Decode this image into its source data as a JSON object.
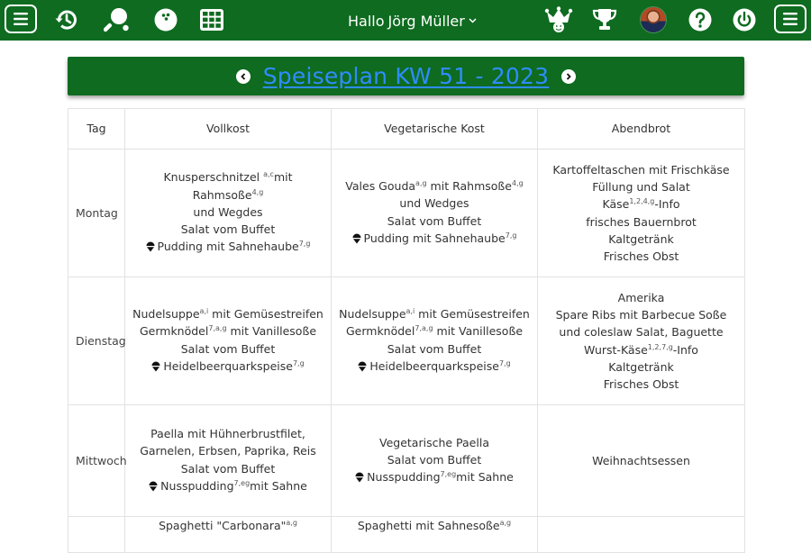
{
  "header": {
    "greeting": "Hallo",
    "user_name": "Jörg Müller"
  },
  "title": "Speiseplan KW 51 - 2023",
  "table": {
    "headers": [
      "Tag",
      "Vollkost",
      "Vegetarische Kost",
      "Abendbrot"
    ],
    "rows": [
      {
        "day": "Montag",
        "vollkost": [
          {
            "t": "Knusperschnitzel ",
            "s": "a,c",
            "a": "mit Rahmsoße",
            "s2": "4,g"
          },
          {
            "t": "und Wegdes"
          },
          {
            "t": "Salat vom Buffet"
          },
          {
            "icon": true,
            "t": "Pudding mit Sahnehaube",
            "s": "7,g"
          }
        ],
        "vegetarisch": [
          {
            "t": "Vales Gouda",
            "s": "a,g",
            "a": " mit Rahmsoße",
            "s2": "4,g"
          },
          {
            "t": "und Wedges"
          },
          {
            "t": "Salat vom Buffet"
          },
          {
            "icon": true,
            "t": "Pudding mit Sahnehaube",
            "s": "7,g"
          }
        ],
        "abendbrot": [
          {
            "t": "Kartoffeltaschen mit Frischkäse Füllung und Salat"
          },
          {
            "t": "Käse",
            "s": "1,2,4,g",
            "a": "-Info"
          },
          {
            "t": "frisches Bauernbrot"
          },
          {
            "t": "Kaltgetränk"
          },
          {
            "t": "Frisches Obst"
          }
        ]
      },
      {
        "day": "Dienstag",
        "vollkost": [
          {
            "t": "Nudelsuppe",
            "s": "a,i",
            "a": " mit Gemüsestreifen"
          },
          {
            "t": "Germknödel",
            "s": "7,a,g",
            "a": " mit Vanillesoße"
          },
          {
            "t": "Salat vom Buffet"
          },
          {
            "icon": true,
            "t": "Heidelbeerquarkspeise",
            "s": "7,g"
          }
        ],
        "vegetarisch": [
          {
            "t": "Nudelsuppe",
            "s": "a,i",
            "a": " mit Gemüsestreifen"
          },
          {
            "t": "Germknödel",
            "s": "7,a,g",
            "a": " mit Vanillesoße"
          },
          {
            "t": "Salat vom Buffet"
          },
          {
            "icon": true,
            "t": "Heidelbeerquarkspeise",
            "s": "7,g"
          }
        ],
        "abendbrot": [
          {
            "t": "Amerika"
          },
          {
            "t": "Spare Ribs mit Barbecue Soße und coleslaw Salat, Baguette"
          },
          {
            "t": "Wurst-Käse",
            "s": "1,2,7,g",
            "a": "-Info"
          },
          {
            "t": "Kaltgetränk"
          },
          {
            "t": "Frisches Obst"
          }
        ]
      },
      {
        "day": "Mittwoch",
        "vollkost": [
          {
            "t": "Paella mit Hühnerbrustfilet, Garnelen, Erbsen, Paprika, Reis"
          },
          {
            "t": "Salat vom Buffet"
          },
          {
            "icon": true,
            "t": "Nusspudding",
            "s": "7,eg",
            "a": "mit Sahne"
          }
        ],
        "vegetarisch": [
          {
            "t": "Vegetarische Paella"
          },
          {
            "t": "Salat vom Buffet"
          },
          {
            "icon": true,
            "t": "Nusspudding",
            "s": "7,eg",
            "a": "mit Sahne"
          }
        ],
        "abendbrot": [
          {
            "t": "Weihnachtsessen"
          }
        ]
      },
      {
        "day": "",
        "vollkost": [
          {
            "t": "Spaghetti \"Carbonara\"",
            "s": "a,g"
          }
        ],
        "vegetarisch": [
          {
            "t": "Spaghetti mit Sahnesoße",
            "s": "a,g"
          }
        ],
        "abendbrot": []
      }
    ]
  },
  "colors": {
    "brand_green": "#0e6b20",
    "title_link": "#2f8cff"
  },
  "icons": [
    "menu-icon",
    "history-icon",
    "table-tennis-icon",
    "bowling-ball-icon",
    "grid-icon",
    "chevron-down-icon",
    "jester-icon",
    "trophy-icon",
    "help-icon",
    "power-icon",
    "chevron-left-icon",
    "chevron-right-icon",
    "dessert-icon"
  ]
}
